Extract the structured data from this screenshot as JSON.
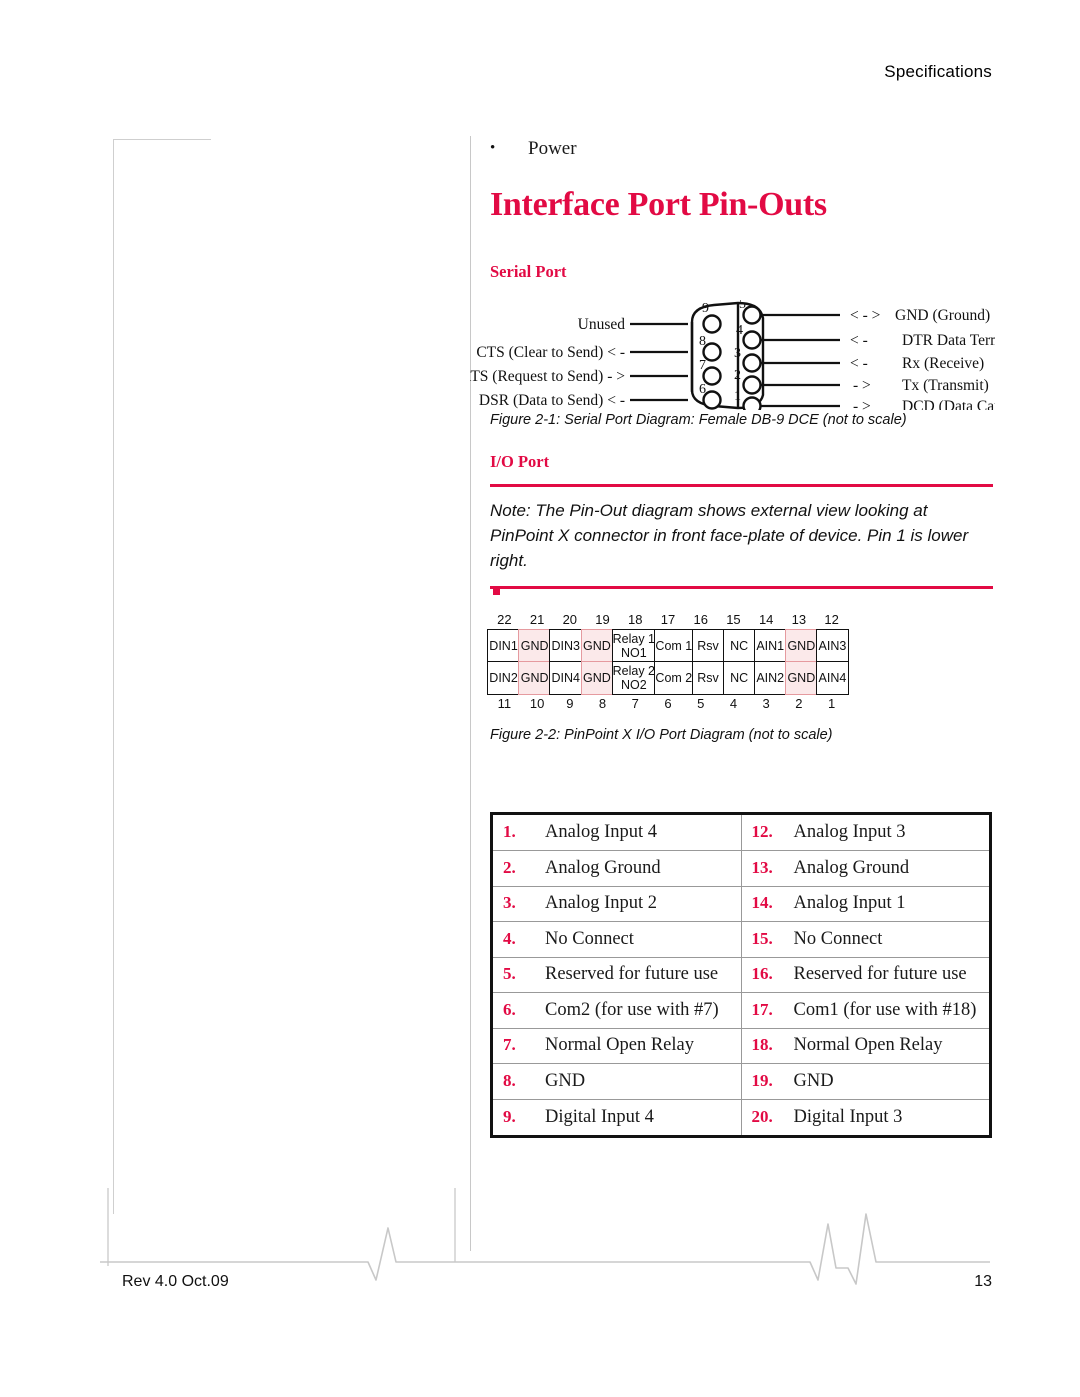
{
  "header": {
    "title": "Specifications"
  },
  "bullets": [
    {
      "marker": "•",
      "label": "Power"
    }
  ],
  "headings": {
    "main": "Interface Port Pin-Outs",
    "serial": "Serial Port",
    "io": "I/O Port"
  },
  "serial_diagram": {
    "left_labels": [
      {
        "text": "Unused",
        "pin": "9"
      },
      {
        "text": "CTS (Clear to Send) < -",
        "pin": "8"
      },
      {
        "text": "RTS (Request to Send)   - >",
        "pin": "7"
      },
      {
        "text": "DSR (Data to Send)  < -",
        "pin": "6"
      }
    ],
    "right_labels": [
      {
        "arrow": "< - >",
        "text": "GND (Ground)",
        "pin": "5"
      },
      {
        "arrow": "< -",
        "text": "DTR Data Terminal Ready)",
        "pin": "4"
      },
      {
        "arrow": "< -",
        "text": "Rx (Receive)",
        "pin": "3"
      },
      {
        "arrow": "- >",
        "text": "Tx (Transmit)",
        "pin": "2"
      },
      {
        "arrow": "- >",
        "text": "DCD (Data Carrier Detect)",
        "pin": "1"
      }
    ],
    "caption": "Figure 2-1:  Serial Port Diagram: Female DB-9 DCE (not to scale)"
  },
  "note": {
    "text": "Note:  The Pin-Out diagram shows external view looking at PinPoint X connector in front face-plate of device. Pin 1 is lower right."
  },
  "io_diagram": {
    "top_numbers": [
      "22",
      "21",
      "20",
      "19",
      "18",
      "17",
      "16",
      "15",
      "14",
      "13",
      "12"
    ],
    "bottom_numbers": [
      "11",
      "10",
      "9",
      "8",
      "7",
      "6",
      "5",
      "4",
      "3",
      "2",
      "1"
    ],
    "top_row": [
      {
        "label": "DIN1",
        "pink": false
      },
      {
        "label": "GND",
        "pink": true
      },
      {
        "label": "DIN3",
        "pink": false
      },
      {
        "label": "GND",
        "pink": true
      },
      {
        "label": "Relay 1",
        "label2": "NO1",
        "pink": false
      },
      {
        "label": "Com 1",
        "pink": false
      },
      {
        "label": "Rsv",
        "pink": false
      },
      {
        "label": "NC",
        "pink": false
      },
      {
        "label": "AIN1",
        "pink": false
      },
      {
        "label": "GND",
        "pink": true
      },
      {
        "label": "AIN3",
        "pink": false
      }
    ],
    "bottom_row": [
      {
        "label": "DIN2",
        "pink": false
      },
      {
        "label": "GND",
        "pink": true
      },
      {
        "label": "DIN4",
        "pink": false
      },
      {
        "label": "GND",
        "pink": true
      },
      {
        "label": "Relay 2",
        "label2": "NO2",
        "pink": false
      },
      {
        "label": "Com 2",
        "pink": false
      },
      {
        "label": "Rsv",
        "pink": false
      },
      {
        "label": "NC",
        "pink": false
      },
      {
        "label": "AIN2",
        "pink": false
      },
      {
        "label": "GND",
        "pink": true
      },
      {
        "label": "AIN4",
        "pink": false
      }
    ],
    "caption": "Figure 2-2:  PinPoint X I/O Port Diagram (not to scale)"
  },
  "pin_table": {
    "rows": [
      {
        "left_num": "1.",
        "left_text": "Analog Input 4",
        "right_num": "12.",
        "right_text": "Analog Input 3"
      },
      {
        "left_num": "2.",
        "left_text": "Analog Ground",
        "right_num": "13.",
        "right_text": "Analog Ground"
      },
      {
        "left_num": "3.",
        "left_text": "Analog Input 2",
        "right_num": "14.",
        "right_text": "Analog Input 1"
      },
      {
        "left_num": "4.",
        "left_text": "No Connect",
        "right_num": "15.",
        "right_text": "No Connect"
      },
      {
        "left_num": "5.",
        "left_text": "Reserved for future use",
        "right_num": "16.",
        "right_text": "Reserved for future use"
      },
      {
        "left_num": "6.",
        "left_text": "Com2 (for use with #7)",
        "right_num": "17.",
        "right_text": "Com1 (for use with #18)"
      },
      {
        "left_num": "7.",
        "left_text": "Normal Open Relay",
        "right_num": "18.",
        "right_text": "Normal Open Relay"
      },
      {
        "left_num": "8.",
        "left_text": "GND",
        "right_num": "19.",
        "right_text": "GND"
      },
      {
        "left_num": "9.",
        "left_text": "Digital Input 4",
        "right_num": "20.",
        "right_text": "Digital Input 3"
      }
    ]
  },
  "footer": {
    "revision": "Rev 4.0  Oct.09",
    "page_number": "13"
  },
  "colors": {
    "accent": "#e20a44",
    "pink_fill": "#fbe9ea",
    "pink_border": "#e59a9f",
    "rule": "#c8c8c8"
  }
}
